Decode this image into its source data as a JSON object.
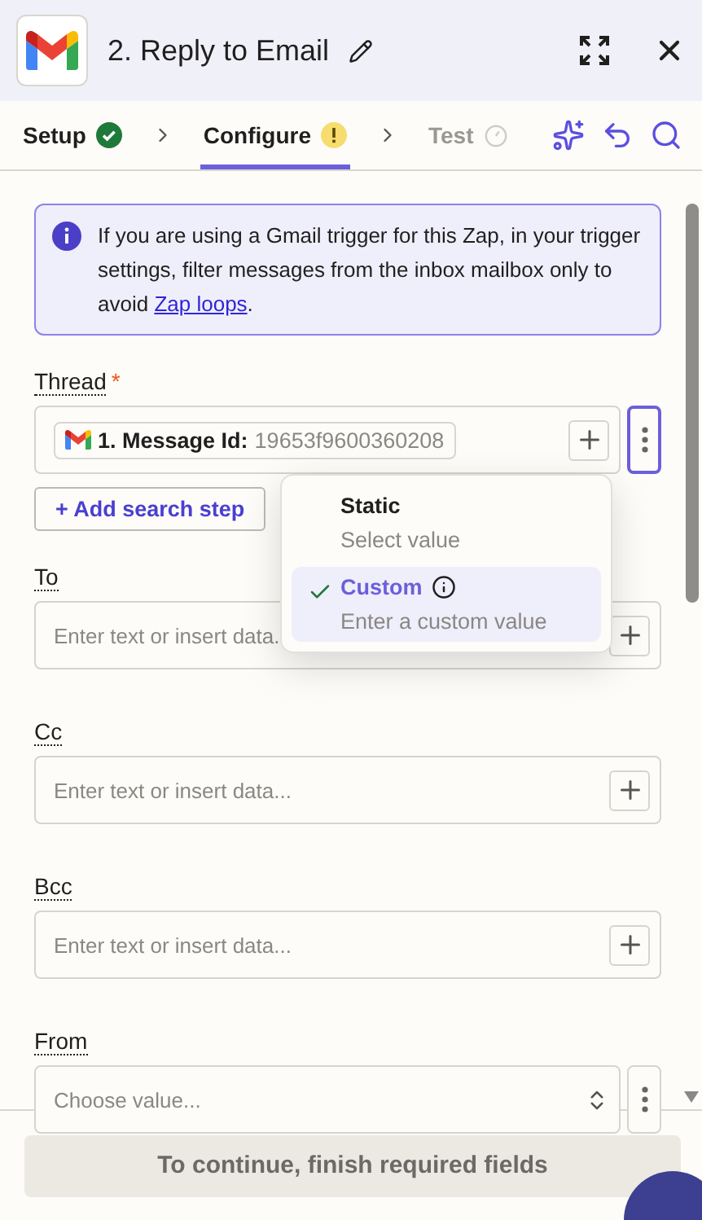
{
  "header": {
    "title": "2. Reply to Email"
  },
  "tabs": [
    {
      "label": "Setup",
      "kind": "done",
      "selected": false
    },
    {
      "label": "Configure",
      "kind": "warning",
      "selected": true
    },
    {
      "label": "Test",
      "kind": "pending",
      "selected": false
    }
  ],
  "notice": {
    "text": "If you are using a Gmail trigger for this Zap, in your trigger settings, filter messages from the inbox mailbox only to avoid ",
    "link": "Zap loops",
    "after": "."
  },
  "thread": {
    "label": "Thread",
    "required_mark": "*",
    "pill_label": "1. Message Id:",
    "pill_value": "19653f9600360208",
    "add_search_step": "+ Add search step",
    "menu_open": true
  },
  "menu": [
    {
      "title": "Static",
      "subtitle": "Select value",
      "selected": false
    },
    {
      "title": "Custom",
      "subtitle": "Enter a custom value",
      "selected": true
    }
  ],
  "fields": [
    {
      "kind": "text",
      "label": "To",
      "placeholder": "Enter text or insert data."
    },
    {
      "kind": "text",
      "label": "Cc",
      "placeholder": "Enter text or insert data..."
    },
    {
      "kind": "text",
      "label": "Bcc",
      "placeholder": "Enter text or insert data..."
    },
    {
      "kind": "select",
      "label": "From",
      "placeholder": "Choose value..."
    }
  ],
  "footer": {
    "button": "To continue, finish required fields",
    "disabled": true
  }
}
